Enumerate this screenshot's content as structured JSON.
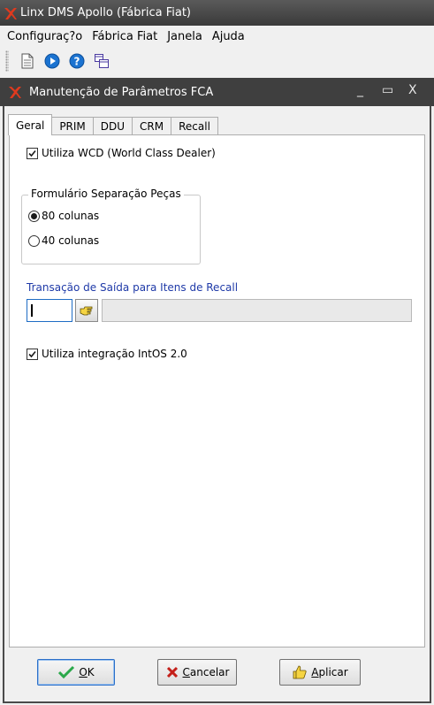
{
  "app": {
    "title": "Linx DMS Apollo (Fábrica Fiat)"
  },
  "menubar": {
    "items": [
      "Configuraç?o",
      "Fábrica Fiat",
      "Janela",
      "Ajuda"
    ]
  },
  "toolbar": {
    "icons": [
      "document-icon",
      "play-circle-icon",
      "help-circle-icon",
      "window-tile-icon"
    ]
  },
  "dialog": {
    "title": "Manutenção de Parâmetros FCA",
    "window_controls": {
      "minimize": "_",
      "maximize": "▭",
      "close": "X"
    },
    "tabs": [
      "Geral",
      "PRIM",
      "DDU",
      "CRM",
      "Recall"
    ],
    "active_tab": "Geral",
    "utiliza_wcd": {
      "label": "Utiliza WCD (World Class Dealer)",
      "checked": true
    },
    "formulario_group": {
      "legend": "Formulário Separação Peças",
      "options": [
        "80 colunas",
        "40 colunas"
      ],
      "selected": "80 colunas"
    },
    "recall_transacao": {
      "label": "Transação de Saída para Itens de Recall",
      "code_value": "",
      "description_value": ""
    },
    "utiliza_intos": {
      "label": "Utiliza integração IntOS 2.0",
      "checked": true
    },
    "buttons": {
      "ok": {
        "mnemonic": "O",
        "rest": "K"
      },
      "cancelar": {
        "mnemonic": "C",
        "rest": "ancelar"
      },
      "aplicar": {
        "mnemonic": "A",
        "rest": "plicar"
      }
    }
  },
  "colors": {
    "accent_label": "#1f3aa8",
    "title_bar": "#3f3f3f",
    "ok_check": "#2aa84a",
    "cancel_x": "#c4201a",
    "logo": "#e03a1e"
  }
}
